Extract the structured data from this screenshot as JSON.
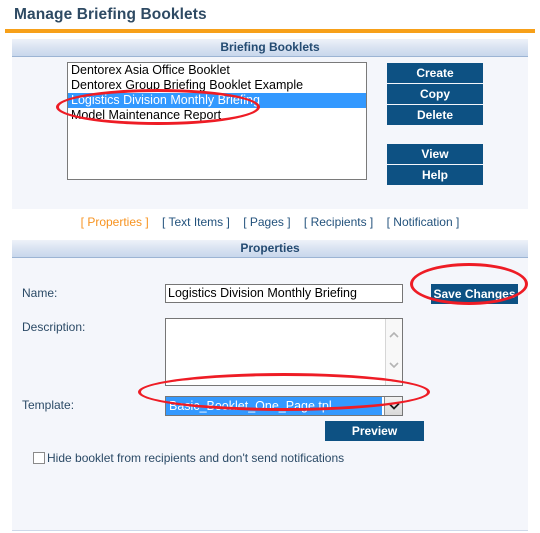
{
  "page": {
    "title": "Manage Briefing Booklets"
  },
  "booklets_section": {
    "header": "Briefing Booklets",
    "items": [
      {
        "label": "Dentorex Asia Office Booklet",
        "selected": false
      },
      {
        "label": "Dentorex Group Briefing Booklet Example",
        "selected": false
      },
      {
        "label": "Logistics Division Monthly Briefing",
        "selected": true
      },
      {
        "label": "Model Maintenance Report",
        "selected": false
      }
    ],
    "buttons": {
      "create": "Create",
      "copy": "Copy",
      "delete": "Delete",
      "view": "View",
      "help": "Help"
    }
  },
  "tabs": [
    {
      "label": "[ Properties ]",
      "active": true
    },
    {
      "label": "[ Text Items ]",
      "active": false
    },
    {
      "label": "[ Pages ]",
      "active": false
    },
    {
      "label": "[ Recipients ]",
      "active": false
    },
    {
      "label": "[ Notification ]",
      "active": false
    }
  ],
  "properties": {
    "header": "Properties",
    "name_label": "Name:",
    "name_value": "Logistics Division Monthly Briefing",
    "save_label": "Save Changes",
    "description_label": "Description:",
    "description_value": "",
    "template_label": "Template:",
    "template_value": "Basic_Booklet_One_Page.tpl",
    "preview_label": "Preview",
    "hide_checkbox_label": "Hide booklet from recipients and don't send notifications",
    "hide_checkbox_checked": false
  },
  "colors": {
    "accent_orange": "#f7a019",
    "button_blue": "#0d5183",
    "selection_blue": "#3399ff",
    "annotation_red": "#ee1c25",
    "panel_bg": "#f4f6fb",
    "header_text": "#244b72"
  },
  "annotations": [
    {
      "name": "highlight-selected-booklet"
    },
    {
      "name": "highlight-save-changes"
    },
    {
      "name": "highlight-template-select"
    }
  ]
}
